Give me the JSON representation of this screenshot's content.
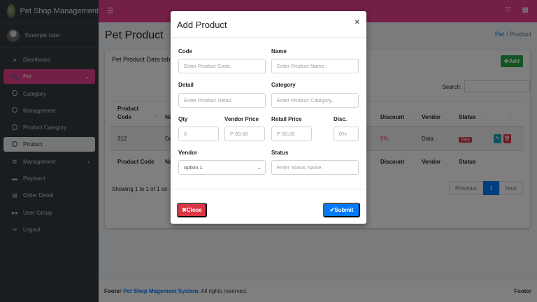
{
  "brand": {
    "name": "Pet Shop Management"
  },
  "user": {
    "name": "Example User"
  },
  "sidebar": {
    "items": [
      {
        "label": "Dashboard",
        "icon": "dashboard-icon"
      },
      {
        "label": "Pet",
        "icon": "paw-icon",
        "active": true
      },
      {
        "label": "Category",
        "icon": "circle-icon"
      },
      {
        "label": "Management",
        "icon": "circle-icon"
      },
      {
        "label": "Product Category",
        "icon": "circle-icon"
      },
      {
        "label": "Product",
        "icon": "circle-icon",
        "selected": true
      },
      {
        "label": "Management",
        "icon": "users-cog-icon"
      },
      {
        "label": "Payment",
        "icon": "credit-card-icon"
      },
      {
        "label": "Order Detail",
        "icon": "cart-icon"
      },
      {
        "label": "User Group",
        "icon": "group-icon"
      },
      {
        "label": "Logout",
        "icon": "logout-icon"
      }
    ]
  },
  "page": {
    "title": "Pet Product",
    "breadcrumb": {
      "home": "Pet",
      "separator": "/",
      "current": "Product"
    }
  },
  "card": {
    "title": "Pet Product Data tab",
    "add_label": "Add",
    "search_label": "Search:"
  },
  "table": {
    "headers": [
      "Product Code",
      "Na",
      "Discount",
      "Vendor",
      "Status"
    ],
    "row": {
      "code": "312",
      "name": "Da",
      "discount": "5%",
      "vendor": "Data",
      "status": "Data"
    },
    "footer": [
      "Product Code",
      "Na",
      "Discount",
      "Vendor",
      "Status"
    ]
  },
  "pagination": {
    "showing": "Showing 1 to 1 of 1 en",
    "previous": "Previous",
    "page": "1",
    "next": "Next"
  },
  "footer": {
    "prefix": "Footer",
    "link": "Pet Shop Magement System.",
    "suffix": "All rights reserved.",
    "right": "Footer"
  },
  "modal": {
    "title": "Add Product",
    "close_icon": "×",
    "fields": {
      "code": {
        "label": "Code",
        "placeholder": "Enter Product Code.."
      },
      "name": {
        "label": "Name",
        "placeholder": "Enter Product Name.."
      },
      "detail": {
        "label": "Detail",
        "placeholder": "Enter Product Detail.."
      },
      "category": {
        "label": "Category",
        "placeholder": "Enter Product Category.."
      },
      "qty": {
        "label": "Qty",
        "placeholder": "0"
      },
      "vendor_price": {
        "label": "Vendor Price",
        "placeholder": "P 00.00"
      },
      "retail_price": {
        "label": "Retail Price",
        "placeholder": "P 00.00"
      },
      "disc": {
        "label": "Disc.",
        "placeholder": "0%"
      },
      "vendor": {
        "label": "Vendor",
        "value": "option 1"
      },
      "status": {
        "label": "Status",
        "placeholder": "Enter Status Name.."
      }
    },
    "close_label": "Close",
    "submit_label": "Submit"
  },
  "colors": {
    "accent_pink": "#e83e8c",
    "sidebar_bg": "#343a40",
    "primary": "#007bff",
    "danger": "#dc3545",
    "success": "#28a745"
  }
}
